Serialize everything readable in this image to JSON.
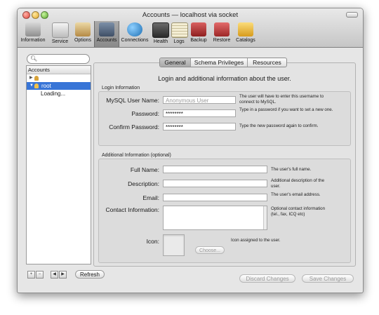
{
  "window": {
    "title": "Accounts — localhost via socket"
  },
  "toolbar": {
    "items": [
      {
        "label": "Information",
        "icon": "information-icon",
        "color": "#b0b0b0"
      },
      {
        "label": "Service",
        "icon": "service-icon",
        "color": "#d8d8d8"
      },
      {
        "label": "Options",
        "icon": "options-icon",
        "color": "#c7a15f"
      },
      {
        "label": "Accounts",
        "icon": "accounts-icon",
        "color": "#566c88"
      },
      {
        "label": "Connections",
        "icon": "connections-icon",
        "color": "#2f8fd0"
      },
      {
        "label": "Health",
        "icon": "health-icon",
        "color": "#4a4a4a"
      },
      {
        "label": "Logs",
        "icon": "logs-icon",
        "color": "#e8e2c6"
      },
      {
        "label": "Backup",
        "icon": "backup-icon",
        "color": "#b73535"
      },
      {
        "label": "Restore",
        "icon": "restore-icon",
        "color": "#c23f3f"
      },
      {
        "label": "Catalogs",
        "icon": "catalogs-icon",
        "color": "#e9b63b"
      }
    ],
    "selected": "Accounts"
  },
  "sidebar": {
    "search_placeholder": "",
    "header": "Accounts",
    "rows": [
      {
        "label": "",
        "icon": "user-icon"
      },
      {
        "label": "root",
        "icon": "user-icon",
        "selected": true
      },
      {
        "label": "Loading..."
      }
    ]
  },
  "tabs": [
    {
      "label": "General",
      "active": true
    },
    {
      "label": "Schema Privileges",
      "active": false
    },
    {
      "label": "Resources",
      "active": false
    }
  ],
  "panel": {
    "title": "Login and additional information about the user.",
    "login": {
      "label": "Login Information",
      "username_label": "MySQL User Name:",
      "username_placeholder": "Anonymous User",
      "username_hint": "The user will have to enter this username to connect to MySQL.",
      "password_label": "Password:",
      "password_value": "********",
      "password_hint": "Type in a password if you want to set a new one.",
      "confirm_label": "Confirm Password:",
      "confirm_value": "********",
      "confirm_hint": "Type the new password again to confirm."
    },
    "additional": {
      "label": "Additional Information (optional)",
      "fullname_label": "Full Name:",
      "fullname_hint": "The user's full name.",
      "description_label": "Description:",
      "description_hint": "Additional description of the user.",
      "email_label": "Email:",
      "email_hint": "The user's email address.",
      "contact_label": "Contact Information:",
      "contact_hint": "Optional contact information (tel., fax, ICQ etc)",
      "icon_label": "Icon:",
      "icon_hint": "Icon assigned to the user.",
      "choose_label": "Choose..."
    }
  },
  "bottom": {
    "refresh_label": "Refresh",
    "discard_label": "Discard Changes",
    "save_label": "Save Changes"
  }
}
